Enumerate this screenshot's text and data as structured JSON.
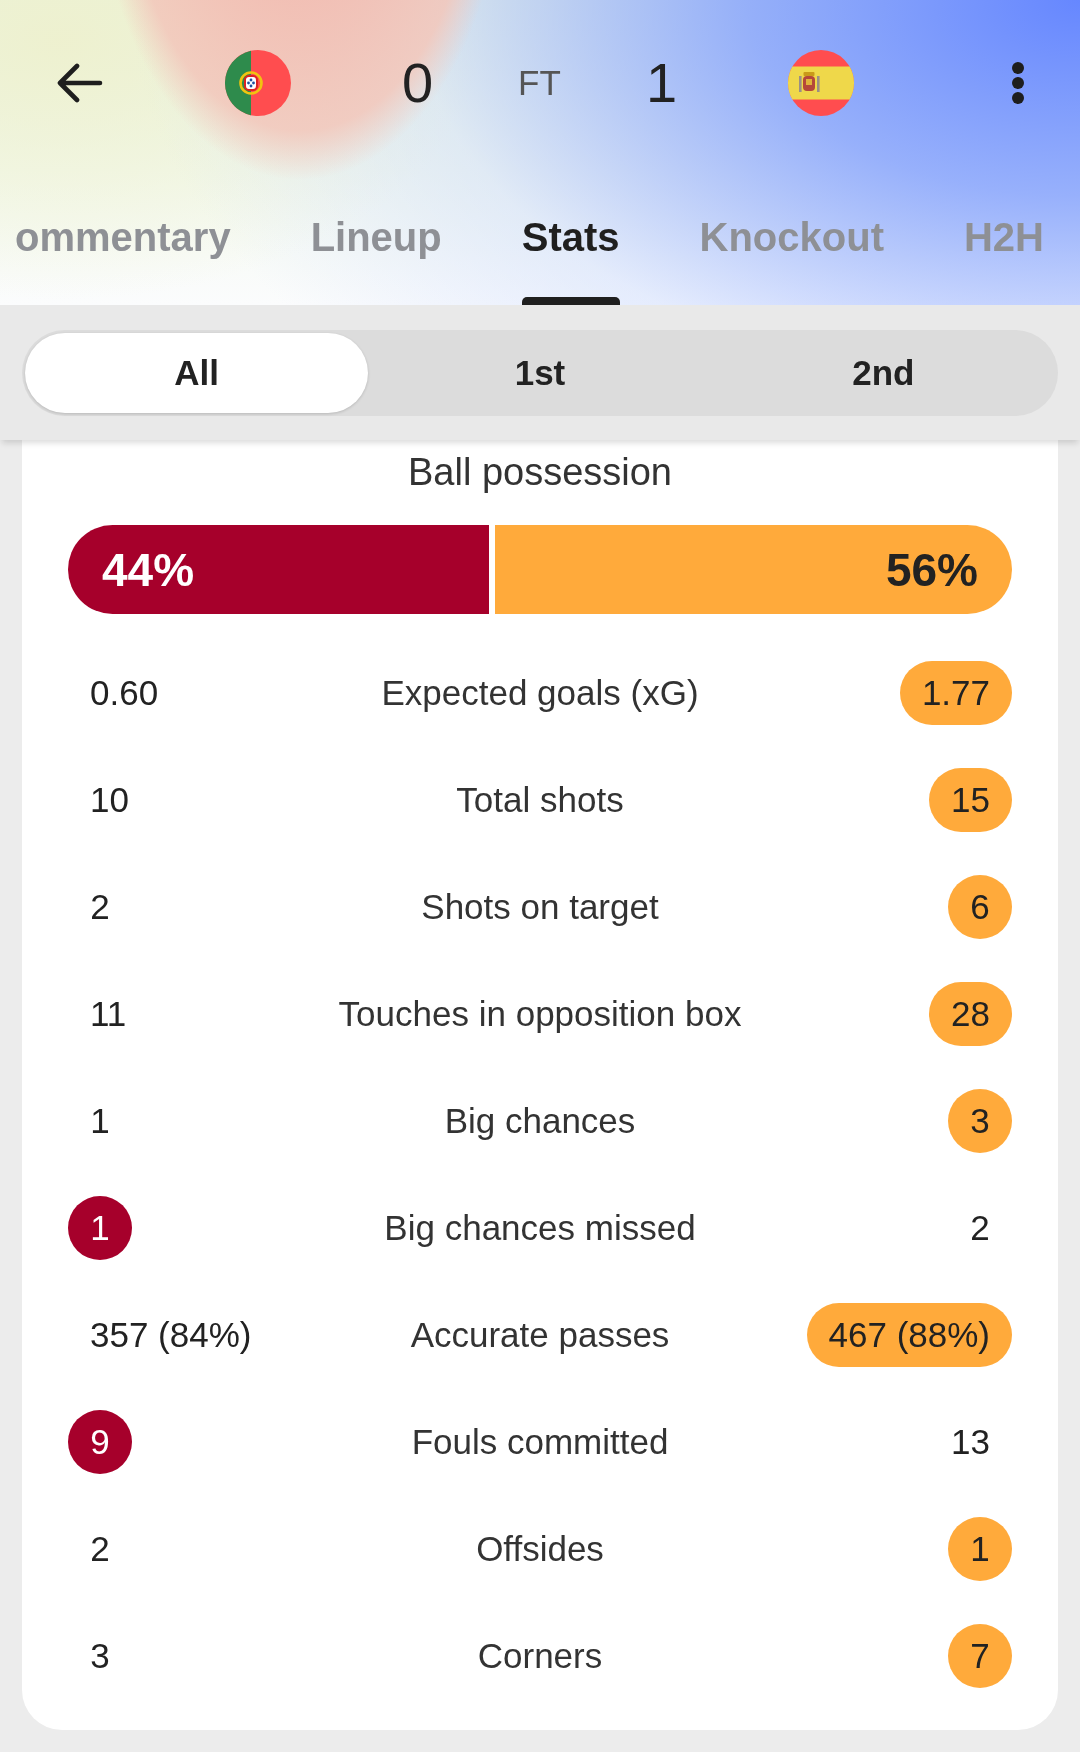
{
  "header": {
    "home_score": "0",
    "status": "FT",
    "away_score": "1"
  },
  "tabs": [
    {
      "label": "ommentary",
      "selected": false
    },
    {
      "label": "Lineup",
      "selected": false
    },
    {
      "label": "Stats",
      "selected": true
    },
    {
      "label": "Knockout",
      "selected": false
    },
    {
      "label": "H2H",
      "selected": false
    }
  ],
  "periods": [
    {
      "label": "All",
      "selected": true
    },
    {
      "label": "1st",
      "selected": false
    },
    {
      "label": "2nd",
      "selected": false
    }
  ],
  "possession": {
    "title": "Ball possession",
    "segments": [
      {
        "value": "44%",
        "level": 0.44,
        "color": "#a6002b"
      },
      {
        "value": "56%",
        "level": 0.56,
        "color": "#ffaa3b"
      }
    ]
  },
  "stats": [
    {
      "label": "Expected goals (xG)",
      "home": {
        "value": "0.60",
        "highlighted": false
      },
      "away": {
        "value": "1.77",
        "highlighted": true
      }
    },
    {
      "label": "Total shots",
      "home": {
        "value": "10",
        "highlighted": false
      },
      "away": {
        "value": "15",
        "highlighted": true
      }
    },
    {
      "label": "Shots on target",
      "home": {
        "value": "2",
        "highlighted": false
      },
      "away": {
        "value": "6",
        "highlighted": true
      }
    },
    {
      "label": "Touches in opposition box",
      "home": {
        "value": "11",
        "highlighted": false
      },
      "away": {
        "value": "28",
        "highlighted": true
      }
    },
    {
      "label": "Big chances",
      "home": {
        "value": "1",
        "highlighted": false
      },
      "away": {
        "value": "3",
        "highlighted": true
      }
    },
    {
      "label": "Big chances missed",
      "home": {
        "value": "1",
        "highlighted": true
      },
      "away": {
        "value": "2",
        "highlighted": false
      }
    },
    {
      "label": "Accurate passes",
      "home": {
        "value": "357 (84%)",
        "highlighted": false
      },
      "away": {
        "value": "467 (88%)",
        "highlighted": true
      }
    },
    {
      "label": "Fouls committed",
      "home": {
        "value": "9",
        "highlighted": true
      },
      "away": {
        "value": "13",
        "highlighted": false
      }
    },
    {
      "label": "Offsides",
      "home": {
        "value": "2",
        "highlighted": false
      },
      "away": {
        "value": "1",
        "highlighted": true
      }
    },
    {
      "label": "Corners",
      "home": {
        "value": "3",
        "highlighted": false
      },
      "away": {
        "value": "7",
        "highlighted": true
      }
    }
  ]
}
